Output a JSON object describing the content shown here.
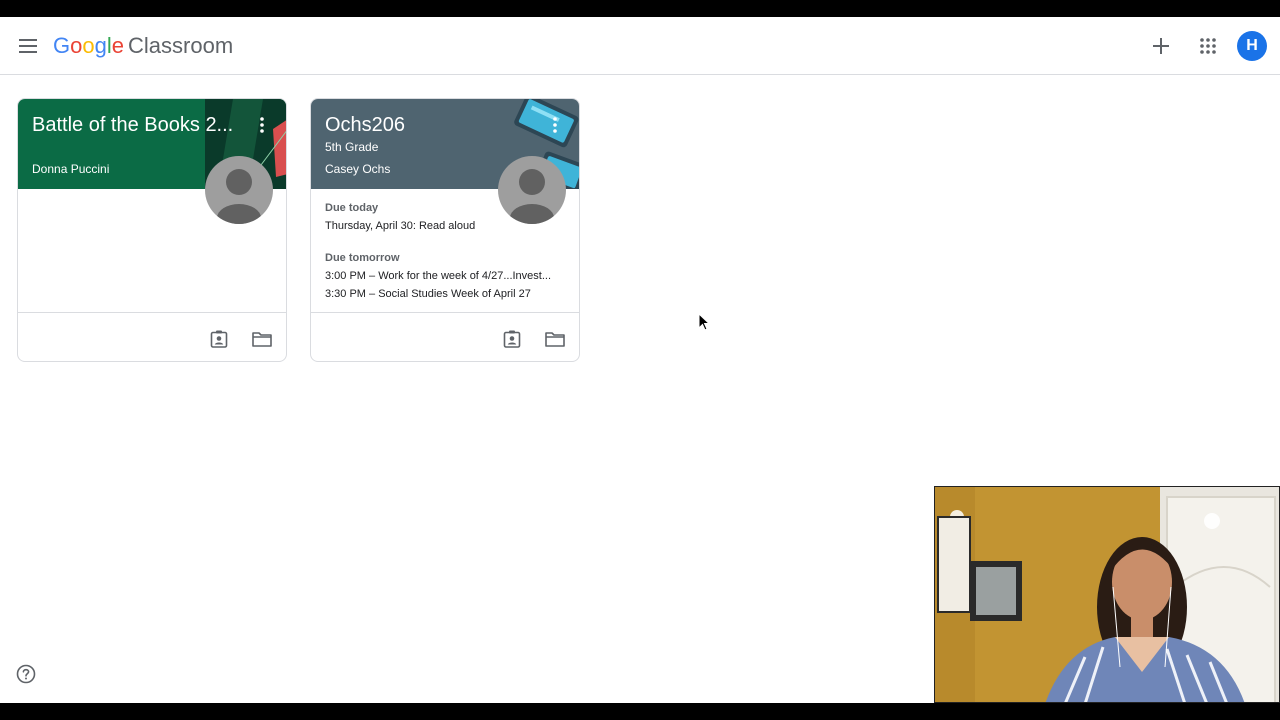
{
  "app": {
    "logo_letters": [
      "G",
      "o",
      "o",
      "g",
      "l",
      "e"
    ],
    "product_name": "Classroom"
  },
  "header": {
    "account_initial": "H",
    "icons": [
      "menu-icon",
      "plus-icon",
      "apps-grid-icon"
    ]
  },
  "classes": [
    {
      "title": "Battle of the Books 2...",
      "section": "",
      "teacher": "Donna Puccini",
      "header_color": "#0b6b45",
      "due_groups": []
    },
    {
      "title": "Ochs206",
      "section": "5th Grade",
      "teacher": "Casey Ochs",
      "header_color": "#4f6470",
      "due_groups": [
        {
          "label": "Due today",
          "items": [
            "Thursday, April 30: Read aloud"
          ]
        },
        {
          "label": "Due tomorrow",
          "items": [
            "3:00 PM – Work for the week of 4/27...Invest...",
            "3:30 PM – Social Studies Week of April 27"
          ]
        }
      ]
    }
  ],
  "colors": {
    "accent": "#1a73e8",
    "border": "#dadce0",
    "icon_gray": "#5f6368"
  }
}
